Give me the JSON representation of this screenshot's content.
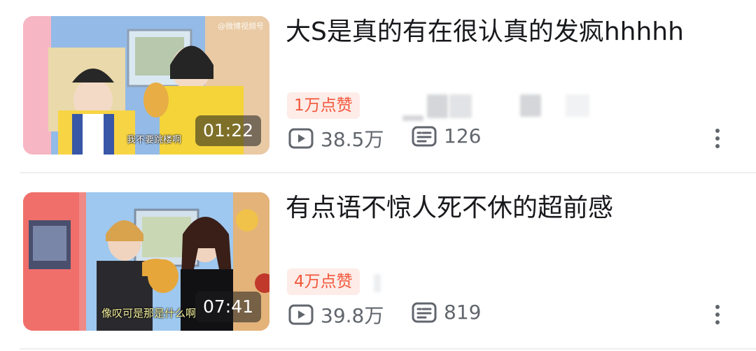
{
  "videos": [
    {
      "title": "大S是真的有在很认真的发疯hhhhh",
      "duration": "01:22",
      "likes": "1万点赞",
      "views": "38.5万",
      "comments": "126",
      "subtitle": "我不要跳楼啊",
      "thumbnail_watermark": "@微博视频号",
      "icons": {
        "views": "play-icon",
        "comments": "danmaku-icon",
        "more": "more-vertical-icon"
      }
    },
    {
      "title": "有点语不惊人死不休的超前感",
      "duration": "07:41",
      "likes": "4万点赞",
      "views": "39.8万",
      "comments": "819",
      "subtitle": "像叹可是那是什么啊",
      "thumbnail_watermark": "",
      "icons": {
        "views": "play-icon",
        "comments": "danmaku-icon",
        "more": "more-vertical-icon"
      }
    }
  ],
  "colors": {
    "like_text": "#f2573b",
    "like_bg": "#fdece8",
    "meta_text": "#61666d",
    "title_text": "#18191c",
    "divider": "#eeeff1"
  }
}
